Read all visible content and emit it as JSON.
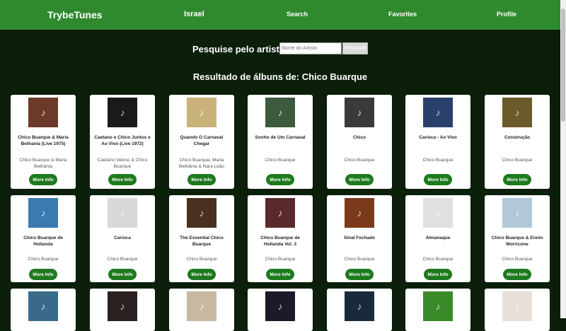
{
  "header": {
    "logo": "TrybeTunes",
    "nav": [
      "Israel",
      "Search",
      "Favorites",
      "Profile"
    ]
  },
  "search": {
    "label": "Pesquise pelo artista:",
    "placeholder": "Nome do Artista",
    "button": "Pesquisar"
  },
  "results": {
    "title": "Resultado de álbuns de: Chico Buarque"
  },
  "more_info_label": "More Info",
  "albums": [
    {
      "title": "Chico Buarque & Maria Bethania (Live 1975)",
      "artist": "Chico Buarque & Maria Bethânia",
      "color": "#6b3a2a"
    },
    {
      "title": "Caetano e Chico Juntos e Ao Vivo (Live 1972)",
      "artist": "Caetano Veloso & Chico Buarque",
      "color": "#1a1a1a"
    },
    {
      "title": "Quando O Carnaval Chegar",
      "artist": "Chico Buarque, Maria Bethânia & Nara Leão",
      "color": "#c9b27a"
    },
    {
      "title": "Sonho de Um Carnaval",
      "artist": "Chico Buarque",
      "color": "#3c5a3c"
    },
    {
      "title": "Chico",
      "artist": "Chico Buarque",
      "color": "#3a3a3a"
    },
    {
      "title": "Carioca - Ao Vivo",
      "artist": "Chico Buarque",
      "color": "#2b3f6b"
    },
    {
      "title": "Construção",
      "artist": "Chico Buarque",
      "color": "#6b5a2a"
    },
    {
      "title": "Chico Buarque de Hollanda",
      "artist": "Chico Buarque",
      "color": "#3a7ab0"
    },
    {
      "title": "Carioca",
      "artist": "Chico Buarque",
      "color": "#d8d8d8"
    },
    {
      "title": "The Essential Chico Buarque",
      "artist": "Chico Buarque",
      "color": "#4a3020"
    },
    {
      "title": "Chico Buarque de Hollanda Vol. 3",
      "artist": "Chico Buarque",
      "color": "#5a2a2a"
    },
    {
      "title": "Sinal Fechado",
      "artist": "Chico Buarque",
      "color": "#7a3a1a"
    },
    {
      "title": "Almanaque",
      "artist": "Chico Buarque",
      "color": "#e0e0e0"
    },
    {
      "title": "Chico Buarque & Ennio Morricone",
      "artist": "Chico Buarque",
      "color": "#b0c8d8"
    },
    {
      "title": "",
      "artist": "",
      "color": "#3a6a8a"
    },
    {
      "title": "",
      "artist": "",
      "color": "#2a2020"
    },
    {
      "title": "",
      "artist": "",
      "color": "#c8b8a0"
    },
    {
      "title": "",
      "artist": "",
      "color": "#1a1a2a"
    },
    {
      "title": "",
      "artist": "",
      "color": "#1a2a3a"
    },
    {
      "title": "",
      "artist": "",
      "color": "#3a8a2a"
    },
    {
      "title": "",
      "artist": "",
      "color": "#e8e0d8"
    }
  ]
}
